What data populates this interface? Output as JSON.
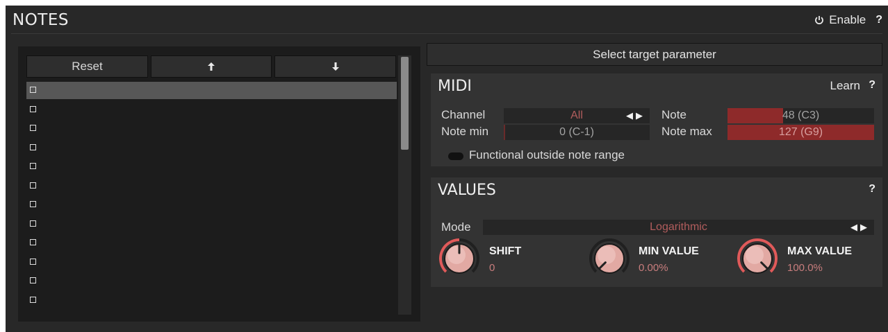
{
  "header": {
    "title": "NOTES",
    "enable_label": "Enable",
    "help": "?"
  },
  "list_toolbar": {
    "reset_label": "Reset",
    "up_label": "🠕",
    "down_label": "🠗"
  },
  "list_rows": 12,
  "select_target_label": "Select target parameter",
  "midi": {
    "title": "MIDI",
    "learn_label": "Learn",
    "help": "?",
    "channel_label": "Channel",
    "channel_value": "All",
    "note_label": "Note",
    "note_value": "48 (C3)",
    "note_fraction": 0.378,
    "note_min_label": "Note min",
    "note_min_value": "0 (C-1)",
    "note_min_fraction": 0.0,
    "note_max_label": "Note max",
    "note_max_value": "127 (G9)",
    "note_max_fraction": 1.0,
    "functional_label": "Functional outside note range",
    "functional_on": false
  },
  "values": {
    "title": "VALUES",
    "help": "?",
    "mode_label": "Mode",
    "mode_value": "Logarithmic",
    "knobs": [
      {
        "label": "SHIFT",
        "value": "0",
        "fraction": 0.5
      },
      {
        "label": "MIN VALUE",
        "value": "0.00%",
        "fraction": 0.0
      },
      {
        "label": "MAX VALUE",
        "value": "100.0%",
        "fraction": 1.0
      }
    ]
  },
  "colors": {
    "accent_red": "#8e2a2a",
    "value_text": "#c87d7d",
    "arc_red": "#e05a5a"
  }
}
